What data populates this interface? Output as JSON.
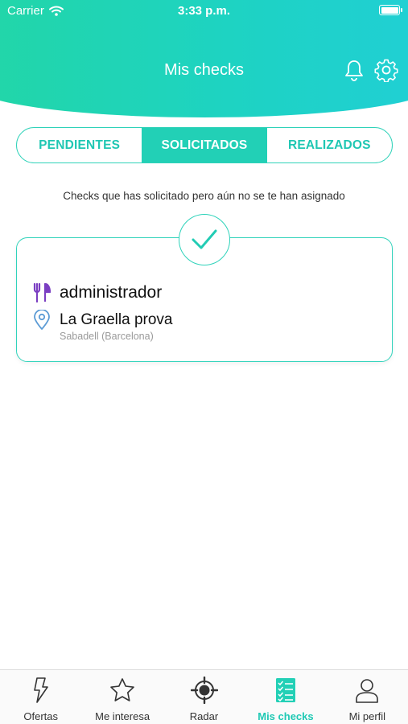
{
  "status": {
    "carrier": "Carrier",
    "time": "3:33 p.m."
  },
  "header": {
    "title": "Mis checks"
  },
  "tabs": [
    {
      "label": "PENDIENTES",
      "active": false
    },
    {
      "label": "SOLICITADOS",
      "active": true
    },
    {
      "label": "REALIZADOS",
      "active": false
    }
  ],
  "subtitle": "Checks que has solicitado pero aún no se te han asignado",
  "card": {
    "role": "administrador",
    "place": "La Graella prova",
    "city": "Sabadell (Barcelona)"
  },
  "tabbar": [
    {
      "label": "Ofertas",
      "icon": "lightning-icon"
    },
    {
      "label": "Me interesa",
      "icon": "star-icon"
    },
    {
      "label": "Radar",
      "icon": "radar-icon"
    },
    {
      "label": "Mis checks",
      "icon": "checklist-icon",
      "active": true
    },
    {
      "label": "Mi perfil",
      "icon": "user-icon"
    }
  ],
  "colors": {
    "accent": "#22d0b6",
    "purple": "#7b3fc2",
    "pin": "#5b9bd5"
  }
}
